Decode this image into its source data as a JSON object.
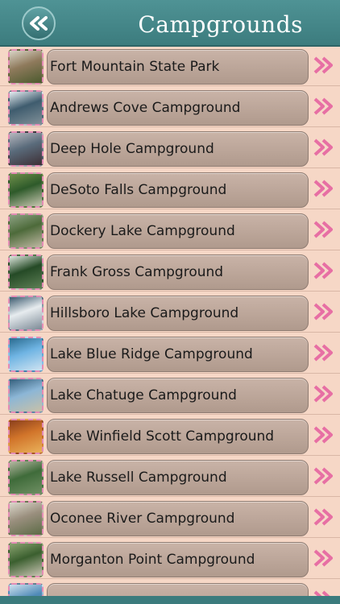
{
  "header": {
    "title": "Campgrounds",
    "back_icon": "double-chevron-left-icon"
  },
  "colors": {
    "header": "#3c7c7e",
    "background": "#f6d7c6",
    "pill": "#bca599",
    "chevron": "#e76fa4",
    "thumb_border": "#e48cb6"
  },
  "campgrounds": [
    {
      "name": "Fort Mountain State Park",
      "thumb": [
        "#8f7a5c",
        "#d9d4c6",
        "#4b5a2e"
      ]
    },
    {
      "name": "Andrews Cove Campground",
      "thumb": [
        "#3f5c6e",
        "#e6edf1",
        "#7f8f97"
      ]
    },
    {
      "name": "Deep Hole Campground",
      "thumb": [
        "#5a6b7b",
        "#b7b8bf",
        "#3d2f35"
      ]
    },
    {
      "name": "DeSoto Falls Campground",
      "thumb": [
        "#2e5a2a",
        "#6f8f4a",
        "#c9c7b2"
      ]
    },
    {
      "name": "Dockery Lake Campground",
      "thumb": [
        "#4d6a3a",
        "#8da283",
        "#bfb8a3"
      ]
    },
    {
      "name": "Frank Gross Campground",
      "thumb": [
        "#254a26",
        "#dfe8df",
        "#5d7f55"
      ]
    },
    {
      "name": "Hillsboro Lake Campground",
      "thumb": [
        "#e7ecef",
        "#3b5a6f",
        "#7c8a96"
      ]
    },
    {
      "name": "Lake Blue Ridge Campground",
      "thumb": [
        "#6fb4e3",
        "#2a6b8f",
        "#cfe3f1"
      ]
    },
    {
      "name": "Lake Chatuge Campground",
      "thumb": [
        "#8cb6d6",
        "#355f7c",
        "#c8c1a8"
      ]
    },
    {
      "name": "Lake Winfield Scott Campground",
      "thumb": [
        "#d1742a",
        "#8a3f1c",
        "#e9b15a"
      ]
    },
    {
      "name": "Lake Russell Campground",
      "thumb": [
        "#3f6b3a",
        "#b6b8a2",
        "#6f8f63"
      ]
    },
    {
      "name": "Oconee River Campground",
      "thumb": [
        "#9a8f7e",
        "#dcd8cc",
        "#5c6b46"
      ]
    },
    {
      "name": "Morganton Point Campground",
      "thumb": [
        "#3b5f2f",
        "#8aa470",
        "#c9c4b3"
      ]
    },
    {
      "name": "",
      "thumb": [
        "#4f8ab8",
        "#cfe2ee",
        "#6a7f88"
      ]
    }
  ]
}
